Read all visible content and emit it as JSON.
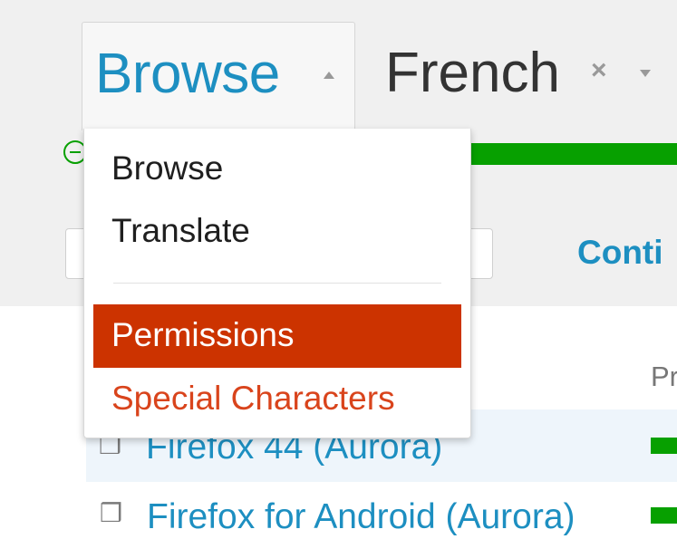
{
  "nav": {
    "tab_browse": "Browse",
    "language": "French",
    "clear_symbol": "×"
  },
  "menu": {
    "items": [
      {
        "label": "Browse"
      },
      {
        "label": "Translate"
      }
    ],
    "permissions_label": "Permissions",
    "special_chars_label": "Special Characters"
  },
  "search": {
    "placeholder": ""
  },
  "contributors_label": "Conti",
  "table": {
    "progress_header": "Pr",
    "rows": [
      {
        "name": "Firefox 44 (Aurora)",
        "progress": 1.0
      },
      {
        "name": "Firefox for Android (Aurora)",
        "progress": 1.0
      }
    ]
  },
  "colors": {
    "link_blue": "#1d8fc1",
    "accent_red": "#cc3300",
    "progress_green": "#07a000"
  },
  "icons": {
    "project": "package-icon",
    "search": "search-icon"
  }
}
